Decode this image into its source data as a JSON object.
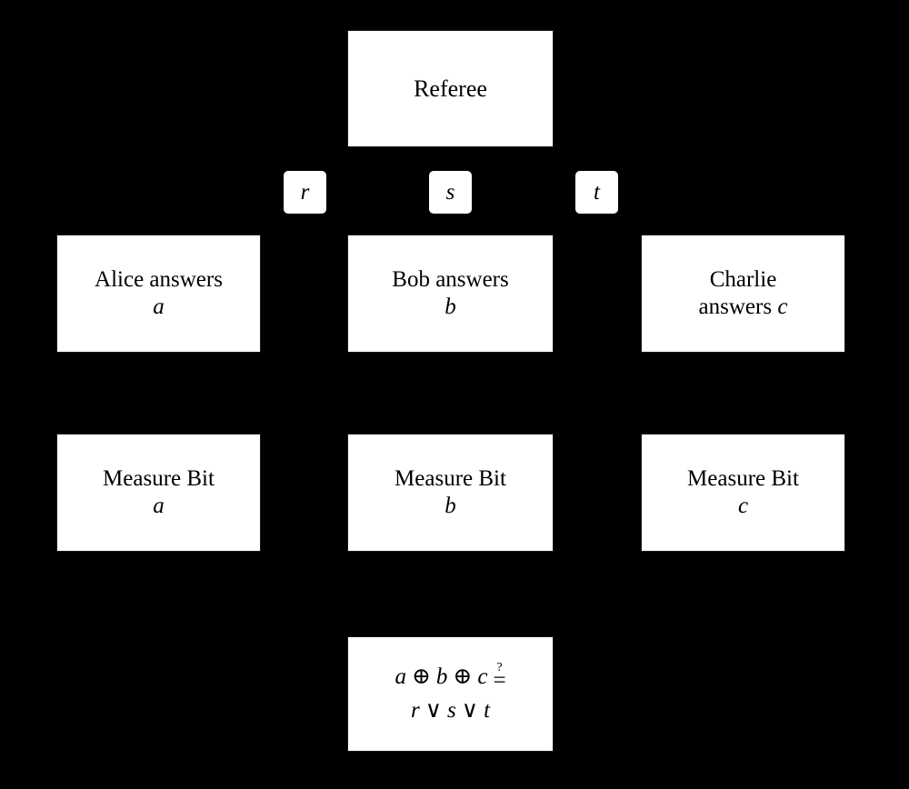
{
  "diagram": {
    "background_color": "#000000",
    "node_fill_color": "#ffffff",
    "node_text_color": "#000000",
    "referee": {
      "label": "Referee"
    },
    "edge_labels": [
      {
        "name": "referee-to-alice",
        "text": "r"
      },
      {
        "name": "referee-to-bob",
        "text": "s"
      },
      {
        "name": "referee-to-charlie",
        "text": "t"
      }
    ],
    "players": [
      {
        "name": "alice",
        "line1": "Alice answers",
        "line2": "a"
      },
      {
        "name": "bob",
        "line1": "Bob answers",
        "line2": "b"
      },
      {
        "name": "charlie",
        "line1": "Charlie",
        "line2_prefix": "answers ",
        "line2_var": "c"
      }
    ],
    "measure": [
      {
        "name": "measure-a",
        "line1": "Measure Bit",
        "line2": "a"
      },
      {
        "name": "measure-b",
        "line1": "Measure Bit",
        "line2": "b"
      },
      {
        "name": "measure-c",
        "line1": "Measure Bit",
        "line2": "c"
      }
    ],
    "formula": {
      "term_a": "a",
      "xor1": "⊕",
      "term_b": "b",
      "xor2": "⊕",
      "term_c": "c",
      "question_mark": "?",
      "equals": "=",
      "term_r": "r",
      "or1": "∨",
      "term_s": "s",
      "or2": "∨",
      "term_t": "t"
    }
  }
}
